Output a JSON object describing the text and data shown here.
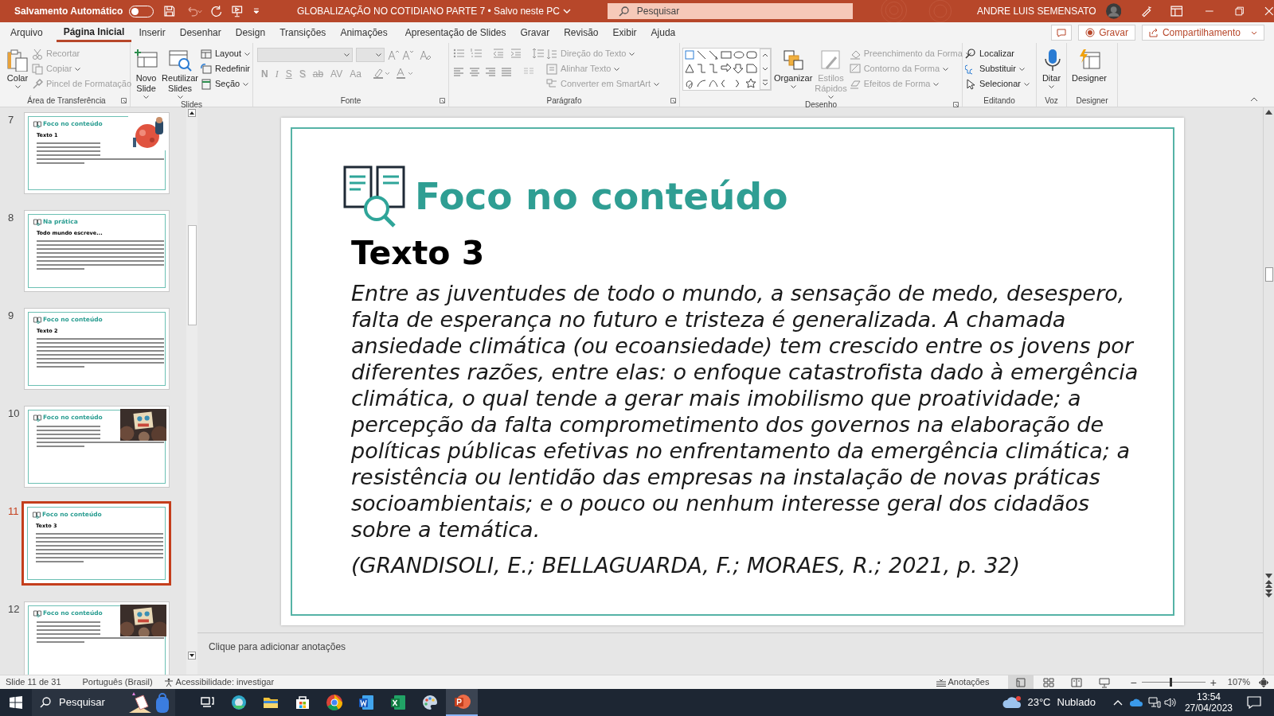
{
  "title_bar": {
    "autosave_label": "Salvamento Automático",
    "autosave_on": false,
    "document_title": "GLOBALIZAÇÃO NO COTIDIANO PARTE 7 • Salvo neste PC",
    "search_placeholder": "Pesquisar",
    "user_name": "ANDRE LUIS SEMENSATO"
  },
  "tabs": [
    {
      "label": "Arquivo",
      "selected": false
    },
    {
      "label": "Página Inicial",
      "selected": true
    },
    {
      "label": "Inserir",
      "selected": false
    },
    {
      "label": "Desenhar",
      "selected": false
    },
    {
      "label": "Design",
      "selected": false
    },
    {
      "label": "Transições",
      "selected": false
    },
    {
      "label": "Animações",
      "selected": false
    },
    {
      "label": "Apresentação de Slides",
      "selected": false
    },
    {
      "label": "Gravar",
      "selected": false
    },
    {
      "label": "Revisão",
      "selected": false
    },
    {
      "label": "Exibir",
      "selected": false
    },
    {
      "label": "Ajuda",
      "selected": false
    }
  ],
  "header_buttons": {
    "record": "Gravar",
    "share": "Compartilhamento"
  },
  "ribbon": [
    {
      "label": "Área de Transferência",
      "items": [
        {
          "kind": "large",
          "label": "Colar",
          "disabled": false
        },
        {
          "kind": "small",
          "label": "Recortar",
          "disabled": true
        },
        {
          "kind": "small",
          "label": "Copiar",
          "disabled": true
        },
        {
          "kind": "small",
          "label": "Pincel de Formatação",
          "disabled": true
        }
      ]
    },
    {
      "label": "Slides",
      "items": [
        {
          "kind": "large",
          "label": "Novo Slide",
          "disabled": false
        },
        {
          "kind": "large",
          "label": "Reutilizar Slides",
          "disabled": false
        },
        {
          "kind": "small",
          "label": "Layout",
          "disabled": false
        },
        {
          "kind": "small",
          "label": "Redefinir",
          "disabled": false
        },
        {
          "kind": "small",
          "label": "Seção",
          "disabled": false
        }
      ]
    },
    {
      "label": "Fonte",
      "items": [
        {
          "kind": "glyph",
          "label": "N",
          "disabled": true
        },
        {
          "kind": "glyph",
          "label": "I",
          "disabled": true
        },
        {
          "kind": "glyph",
          "label": "S",
          "disabled": true
        },
        {
          "kind": "glyph",
          "label": "S",
          "disabled": true
        },
        {
          "kind": "glyph",
          "label": "ab",
          "disabled": true
        },
        {
          "kind": "glyph",
          "label": "AV",
          "disabled": true
        },
        {
          "kind": "glyph",
          "label": "Aa",
          "disabled": true
        }
      ]
    },
    {
      "label": "Parágrafo",
      "items": [
        {
          "kind": "small",
          "label": "Direção do Texto",
          "disabled": true
        },
        {
          "kind": "small",
          "label": "Alinhar Texto",
          "disabled": true
        },
        {
          "kind": "small",
          "label": "Converter em SmartArt",
          "disabled": true
        }
      ]
    },
    {
      "label": "Desenho",
      "items": [
        {
          "kind": "gallery"
        },
        {
          "kind": "large",
          "label": "Organizar",
          "disabled": false
        },
        {
          "kind": "large",
          "label": "Estilos Rápidos",
          "disabled": true
        },
        {
          "kind": "small",
          "label": "Preenchimento da Forma",
          "disabled": true
        },
        {
          "kind": "small",
          "label": "Contorno da Forma",
          "disabled": true
        },
        {
          "kind": "small",
          "label": "Efeitos de Forma",
          "disabled": true
        }
      ]
    },
    {
      "label": "Editando",
      "items": [
        {
          "kind": "small",
          "label": "Localizar",
          "disabled": false
        },
        {
          "kind": "small",
          "label": "Substituir",
          "disabled": false
        },
        {
          "kind": "small",
          "label": "Selecionar",
          "disabled": false
        }
      ]
    },
    {
      "label": "Voz",
      "items": [
        {
          "kind": "large",
          "label": "Ditar",
          "disabled": false
        }
      ]
    },
    {
      "label": "Designer",
      "items": [
        {
          "kind": "large",
          "label": "Designer",
          "disabled": false
        }
      ]
    }
  ],
  "thumbnails": [
    {
      "number": "7",
      "selected": false,
      "heading": "Foco no conteúdo",
      "subheading": "Texto 1",
      "has_picture": true
    },
    {
      "number": "8",
      "selected": false,
      "heading": "Na prática",
      "subheading": "Todo mundo escreve...",
      "has_picture": false
    },
    {
      "number": "9",
      "selected": false,
      "heading": "Foco no conteúdo",
      "subheading": "Texto 2",
      "has_picture": false
    },
    {
      "number": "10",
      "selected": false,
      "heading": "Foco no conteúdo",
      "has_picture": true
    },
    {
      "number": "11",
      "selected": true,
      "heading": "Foco no conteúdo",
      "subheading": "Texto 3",
      "has_picture": false
    },
    {
      "number": "12",
      "selected": false,
      "heading": "Foco no conteúdo",
      "has_picture": true
    }
  ],
  "slide": {
    "title": "Foco no conteúdo",
    "subtitle": "Texto 3",
    "body": "Entre as juventudes de todo o mundo, a sensação de medo, desespero, falta de esperança no futuro e tristeza é generalizada. A chamada ansiedade climática (ou ecoansiedade) tem crescido entre os jovens por diferentes razões, entre elas: o enfoque catastrofista dado à emergência climática, o qual tende a gerar mais imobilismo que proatividade; a percepção da falta comprometimento dos governos na elaboração de políticas públicas efetivas no enfrentamento da emergência climática; a resistência ou lentidão das empresas na instalação de novas práticas socioambientais; e o pouco ou nenhum interesse geral dos cidadãos sobre a temática.",
    "citation": "(GRANDISOLI, E.; BELLAGUARDA, F.; MORAES, R.; 2021, p. 32)"
  },
  "notes_placeholder": "Clique para adicionar anotações",
  "status_bar": {
    "slide_count": "Slide 11 de 31",
    "language": "Português (Brasil)",
    "accessibility": "Acessibilidade: investigar",
    "notes": "Anotações",
    "zoom_out": "−",
    "zoom_in": "+",
    "zoom": "107%",
    "zoom_slider": {
      "level": 0.45
    }
  },
  "taskbar": {
    "search_placeholder": "Pesquisar",
    "apps": [
      {
        "kind": "taskview",
        "selected": false
      },
      {
        "kind": "edge",
        "selected": false
      },
      {
        "kind": "files",
        "selected": false
      },
      {
        "kind": "store",
        "selected": false
      },
      {
        "kind": "chrome",
        "selected": false
      },
      {
        "kind": "word",
        "selected": false
      },
      {
        "kind": "excel",
        "selected": false
      },
      {
        "kind": "paint",
        "selected": false
      },
      {
        "kind": "powerpoint",
        "selected": true
      }
    ],
    "temperature": "23°C",
    "weather": "Nublado",
    "time": "13:54",
    "date": "27/04/2023"
  }
}
